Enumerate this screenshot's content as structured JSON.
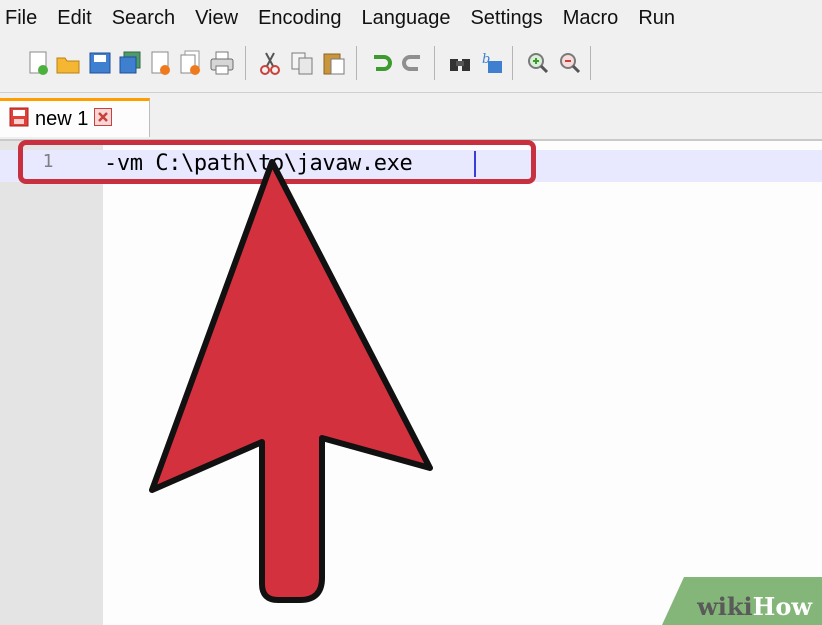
{
  "menu": [
    "File",
    "Edit",
    "Search",
    "View",
    "Encoding",
    "Language",
    "Settings",
    "Macro",
    "Run"
  ],
  "toolbar": {
    "icons": [
      "new-file-icon",
      "open-file-icon",
      "save-icon",
      "save-all-icon",
      "close-icon",
      "close-all-icon",
      "print-icon",
      "cut-icon",
      "copy-icon",
      "paste-icon",
      "undo-icon",
      "redo-icon",
      "find-icon",
      "replace-icon",
      "zoom-in-icon",
      "zoom-out-icon"
    ]
  },
  "tab": {
    "label": "new 1"
  },
  "editor": {
    "line_number": "1",
    "code": "-vm C:\\path\\to\\javaw.exe"
  },
  "watermark": {
    "wiki": "wiki",
    "how": "How"
  },
  "colors": {
    "annotation": "#c8303f",
    "tab_accent": "#ff9c00",
    "watermark_bg": "#84b67a"
  }
}
